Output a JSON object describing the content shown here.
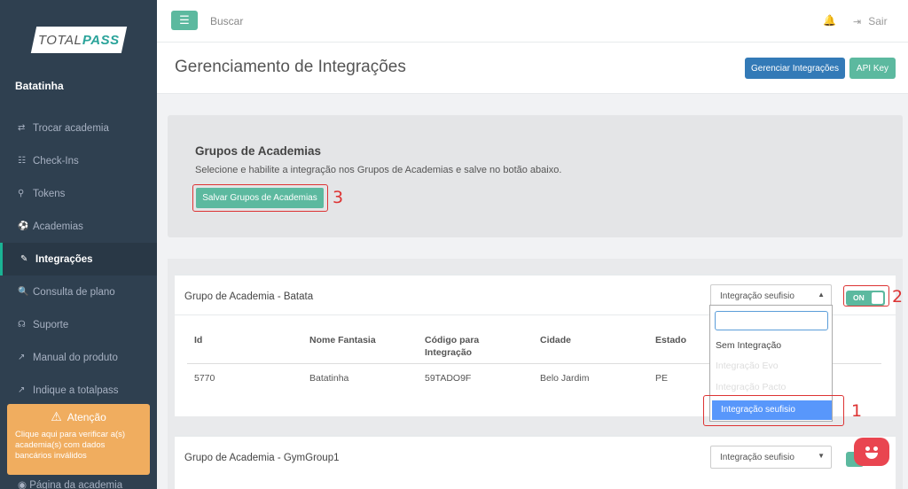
{
  "sidebar": {
    "logo": {
      "part1": "TOTAL",
      "part2": "PASS"
    },
    "user": "Batatinha",
    "items": [
      {
        "icon": "⇄",
        "label": "Trocar academia"
      },
      {
        "icon": "☷",
        "label": "Check-Ins"
      },
      {
        "icon": "⚲",
        "label": "Tokens"
      },
      {
        "icon": "⚽",
        "label": "Academias"
      },
      {
        "icon": "✎",
        "label": "Integrações"
      },
      {
        "icon": "🔍",
        "label": "Consulta de plano"
      },
      {
        "icon": "☊",
        "label": "Suporte"
      },
      {
        "icon": "↗",
        "label": "Manual do produto"
      },
      {
        "icon": "↗",
        "label": "Indique a totalpass"
      }
    ],
    "attention": {
      "title": "Atenção",
      "text": "Clique aqui para verificar a(s) academia(s) com dados bancários inválidos"
    },
    "last_item": "Página da academia"
  },
  "topbar": {
    "search_label": "Buscar",
    "logout_label": "Sair"
  },
  "heading": {
    "title": "Gerenciamento de Integrações",
    "manage_button": "Gerenciar Integrações",
    "api_button": "API Key"
  },
  "groups": {
    "title": "Grupos de Academias",
    "description": "Selecione e habilite a integração nos Grupos de Academias e salve no botão abaixo.",
    "save_button": "Salvar Grupos de Academias"
  },
  "annotations": {
    "one": "1",
    "two": "2",
    "three": "3"
  },
  "cards": [
    {
      "title": "Grupo de Academia - Batata",
      "select_value": "Integração seufisio",
      "toggle": "ON",
      "columns": [
        "Id",
        "Nome Fantasia",
        "Código para Integração",
        "Cidade",
        "Estado"
      ],
      "row": [
        "5770",
        "Batatinha",
        "59TADO9F",
        "Belo Jardim",
        "PE"
      ]
    },
    {
      "title": "Grupo de Academia - GymGroup1",
      "select_value": "Integração seufisio"
    }
  ],
  "dropdown": {
    "options": [
      "Sem Integração",
      "Integração Evo",
      "Integração Pacto",
      "Integração seufisio"
    ]
  },
  "colors": {
    "sidebar": "#2f4050",
    "accent_green": "#5cb99f",
    "primary_blue": "#337ab7",
    "warning": "#f0ad5f",
    "annotation_red": "#dd3333"
  }
}
